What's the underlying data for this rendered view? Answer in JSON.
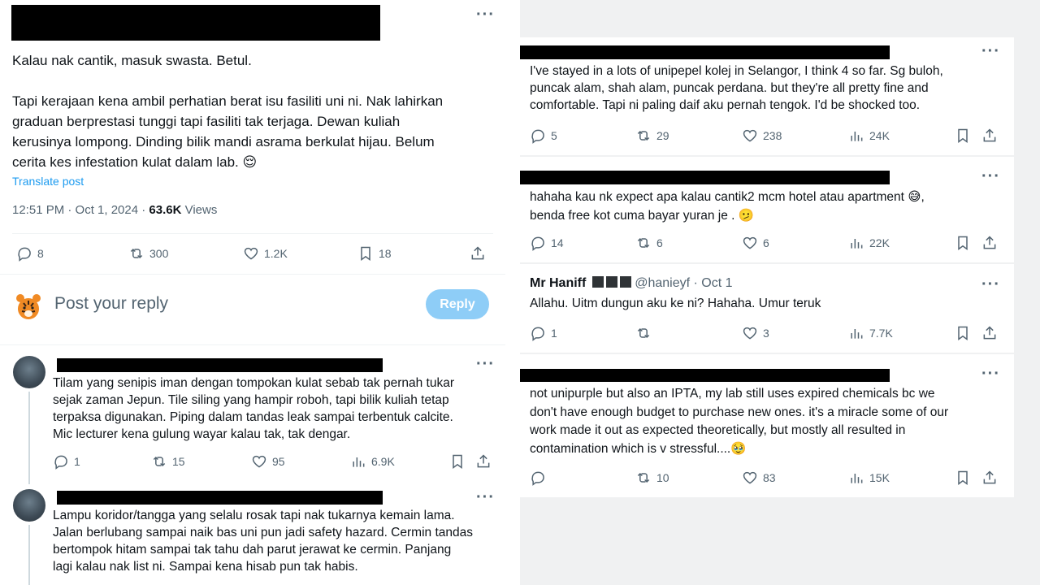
{
  "main_tweet": {
    "paragraph1": "Kalau nak cantik, masuk swasta. Betul.",
    "paragraph2": "Tapi kerajaan kena ambil perhatian berat isu fasiliti uni ni. Nak lahirkan\ngraduan berprestasi tunggi tapi fasiliti tak terjaga. Dewan kuliah\nkerusinya lompong. Dinding bilik mandi asrama berkulat hijau. Belum\ncerita kes infestation kulat dalam lab. 😌",
    "translate_label": "Translate post",
    "time_date": "12:51 PM · Oct 1, 2024 · ",
    "views_count": "63.6K",
    "views_label": " Views",
    "replies": "8",
    "reposts": "300",
    "likes": "1.2K",
    "bookmarks": "18"
  },
  "composer": {
    "placeholder": "Post your reply",
    "reply_button": "Reply"
  },
  "left_replies": [
    {
      "text": "Tilam yang senipis iman dengan tompokan kulat sebab tak pernah tukar\nsejak zaman Jepun. Tile siling yang hampir roboh, tapi bilik kuliah tetap\nterpaksa digunakan. Piping dalam tandas leak sampai terbentuk calcite.\nMic lecturer kena gulung wayar kalau tak, tak dengar.",
      "replies": "1",
      "reposts": "15",
      "likes": "95",
      "views": "6.9K"
    },
    {
      "text": "Lampu koridor/tangga yang selalu rosak tapi nak tukarnya kemain lama.\nJalan berlubang sampai naik bas uni pun jadi safety hazard. Cermin tandas\nbertompok hitam sampai tak tahu dah parut jerawat ke cermin. Panjang\nlagi kalau nak list ni. Sampai kena hisab pun tak habis."
    }
  ],
  "right_replies": [
    {
      "text": "I've stayed in a lots of unipepel kolej in Selangor, I think 4 so far. Sg buloh,\npuncak alam, shah alam, puncak perdana. but they're all pretty fine and\ncomfortable. Tapi ni paling daif aku pernah tengok. I'd be shocked too.",
      "replies": "5",
      "reposts": "29",
      "likes": "238",
      "views": "24K"
    },
    {
      "text": "hahaha kau nk expect apa kalau cantik2 mcm hotel atau apartment 😅,\nbenda free kot cuma bayar yuran je . 🫤",
      "replies": "14",
      "reposts": "6",
      "likes": "6",
      "views": "22K"
    },
    {
      "name": "Mr Haniff",
      "handle": "@hanieyf · Oct 1",
      "text": "Allahu. Uitm dungun aku ke ni? Hahaha. Umur teruk",
      "replies": "1",
      "reposts": "",
      "likes": "3",
      "views": "7.7K"
    },
    {
      "text": "not unipurple but also an IPTA, my lab still uses expired chemicals bc we\ndon't have enough budget to purchase new ones. it's a miracle some of our\nwork made it out as expected theoretically, but mostly all resulted in\ncontamination which is v stressful....🥹",
      "replies": "",
      "reposts": "10",
      "likes": "83",
      "views": "15K"
    }
  ]
}
